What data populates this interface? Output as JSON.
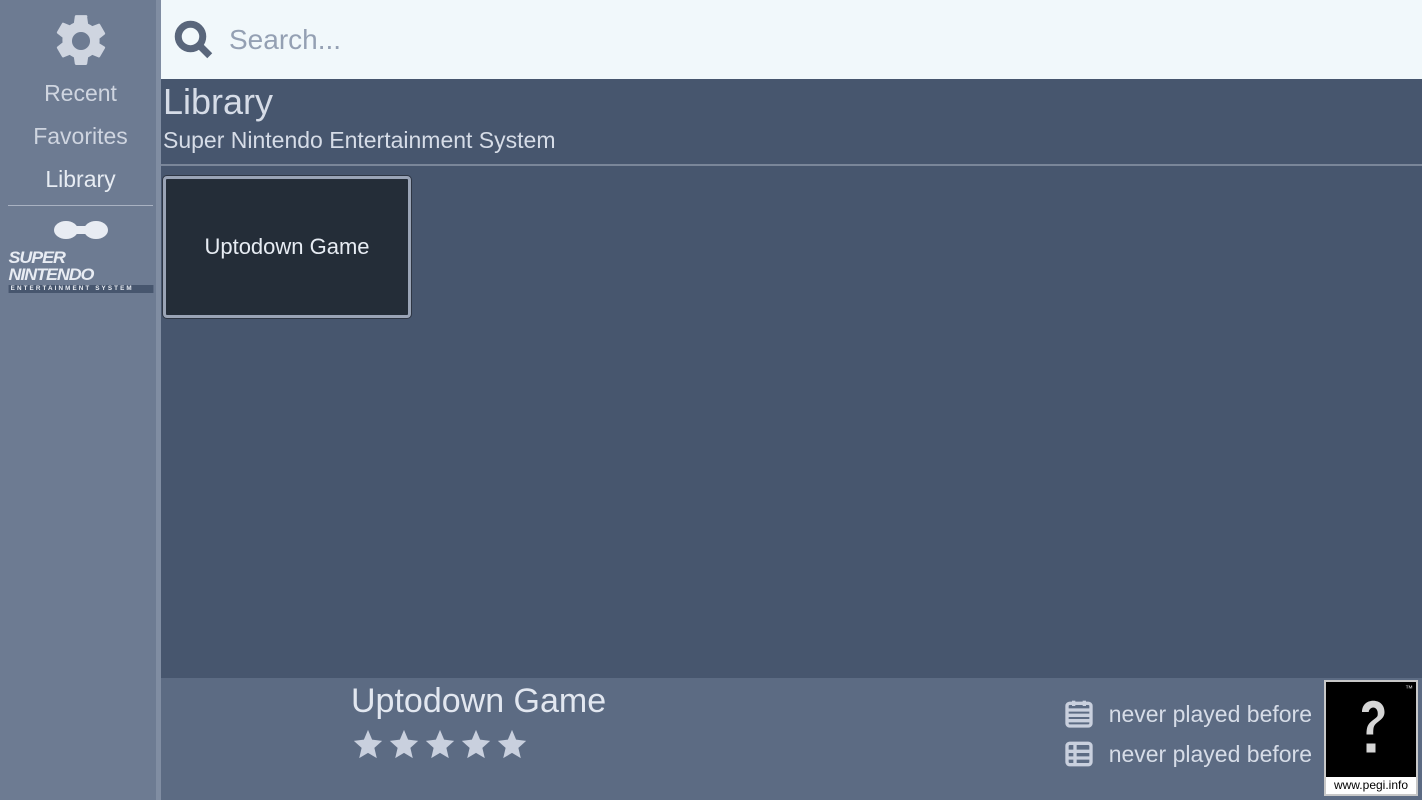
{
  "sidebar": {
    "nav": [
      {
        "key": "recent",
        "label": "Recent",
        "active": false
      },
      {
        "key": "favorites",
        "label": "Favorites",
        "active": false
      },
      {
        "key": "library",
        "label": "Library",
        "active": true
      }
    ],
    "platform_logo": {
      "wordmark": "SUPER NINTENDO",
      "subline": "ENTERTAINMENT SYSTEM"
    }
  },
  "search": {
    "placeholder": "Search..."
  },
  "header": {
    "title": "Library",
    "subtitle": "Super Nintendo Entertainment System"
  },
  "games": [
    {
      "title": "Uptodown Game"
    }
  ],
  "detail": {
    "title": "Uptodown Game",
    "rating_stars": 5,
    "last_played_text": "never played before",
    "play_count_text": "never played before"
  },
  "pegi": {
    "tm": "™",
    "url": "www.pegi.info"
  }
}
